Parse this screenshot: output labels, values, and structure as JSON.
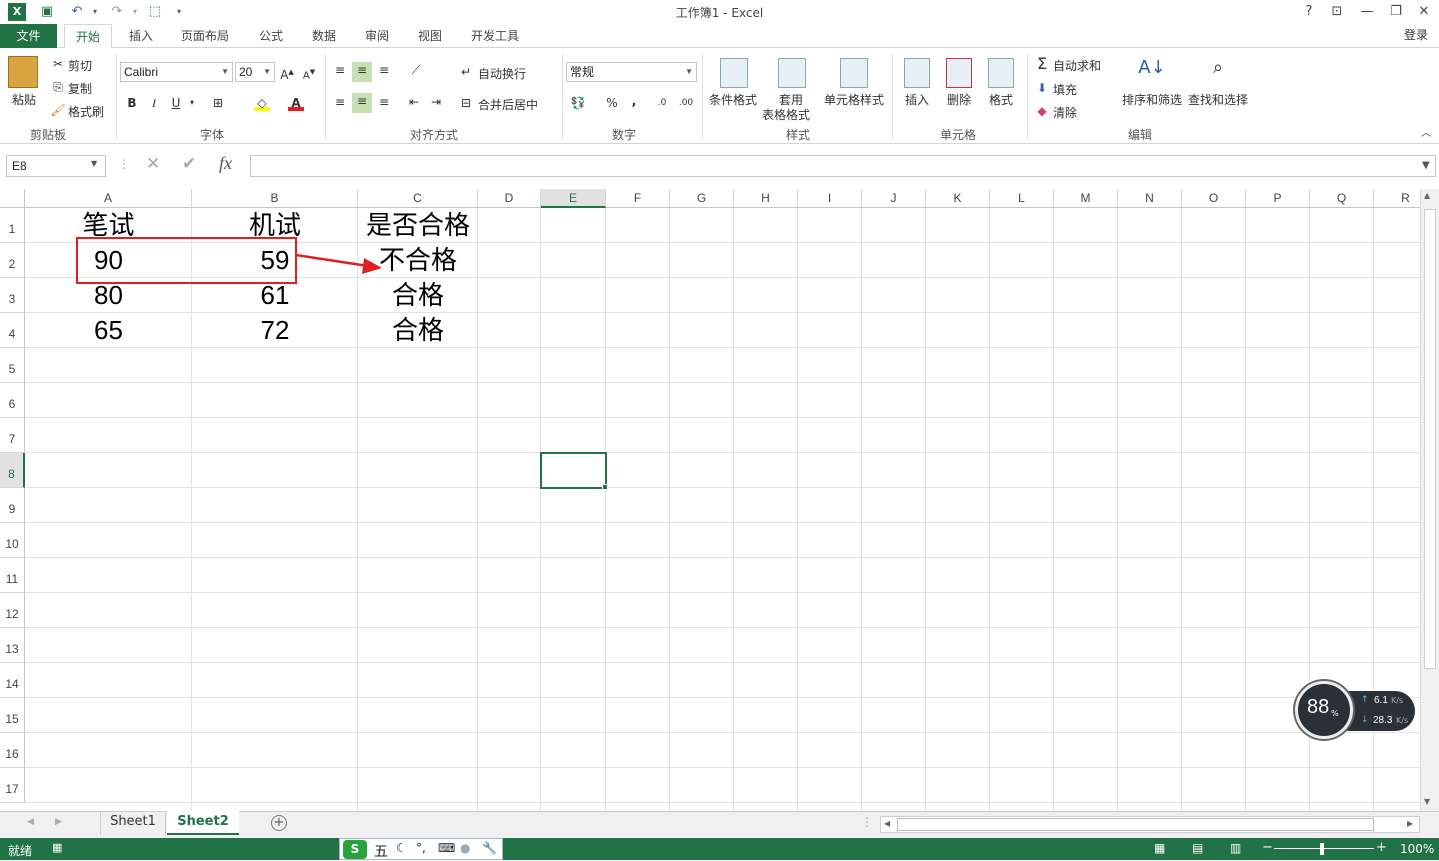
{
  "window": {
    "title": "工作簿1 - Excel",
    "login_label": "登录",
    "help_label": "?"
  },
  "tabs": [
    {
      "label": "文件"
    },
    {
      "label": "开始"
    },
    {
      "label": "插入"
    },
    {
      "label": "页面布局"
    },
    {
      "label": "公式"
    },
    {
      "label": "数据"
    },
    {
      "label": "审阅"
    },
    {
      "label": "视图"
    },
    {
      "label": "开发工具"
    }
  ],
  "ribbon": {
    "clipboard": {
      "paste": "粘贴",
      "cut": "剪切",
      "copy": "复制",
      "format_painter": "格式刷",
      "group": "剪贴板"
    },
    "font": {
      "name": "Calibri",
      "size": "20",
      "bold": "B",
      "italic": "I",
      "underline": "U",
      "group": "字体"
    },
    "align": {
      "wrap": "自动换行",
      "merge": "合并后居中",
      "group": "对齐方式"
    },
    "number": {
      "format": "常规",
      "percent": "%",
      "comma": ",",
      "group": "数字"
    },
    "styles": {
      "conditional": "条件格式",
      "table_1": "套用",
      "table_2": "表格格式",
      "cell_styles": "单元格样式",
      "group": "样式"
    },
    "cells": {
      "insert": "插入",
      "delete": "删除",
      "format": "格式",
      "group": "单元格"
    },
    "editing": {
      "autosum": "自动求和",
      "fill": "填充",
      "clear": "清除",
      "sort": "排序和筛选",
      "find": "查找和选择",
      "group": "编辑"
    }
  },
  "formula_bar": {
    "name_box": "E8",
    "fx": "fx",
    "value": ""
  },
  "columns": [
    "A",
    "B",
    "C",
    "D",
    "E",
    "F",
    "G",
    "H",
    "I",
    "J",
    "K",
    "L",
    "M",
    "N",
    "O",
    "P",
    "Q",
    "R"
  ],
  "rows": [
    "1",
    "2",
    "3",
    "4",
    "5",
    "6",
    "7",
    "8",
    "9",
    "10",
    "11",
    "12",
    "13",
    "14",
    "15",
    "16",
    "17"
  ],
  "cells": {
    "A1": "笔试",
    "B1": "机试",
    "C1": "是否合格",
    "A2": "90",
    "B2": "59",
    "C2": "不合格",
    "A3": "80",
    "B3": "61",
    "C3": "合格",
    "A4": "65",
    "B4": "72",
    "C4": "合格"
  },
  "selected_cell": "E8",
  "sheets": [
    {
      "label": "Sheet1"
    },
    {
      "label": "Sheet2"
    }
  ],
  "active_sheet": "Sheet2",
  "status": {
    "ready": "就绪",
    "zoom": "100%",
    "ime_label": "五"
  },
  "net_widget": {
    "percent": "88",
    "percent_unit": "%",
    "up": "6.1",
    "up_unit": "K/s",
    "down": "28.3",
    "down_unit": "K/s"
  },
  "colors": {
    "accent": "#217346",
    "annotation": "#e02020"
  }
}
